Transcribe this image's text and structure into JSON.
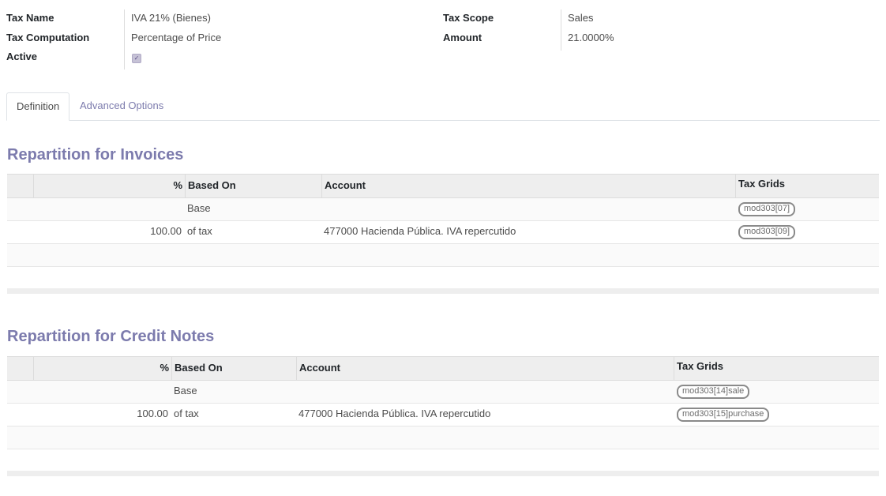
{
  "header": {
    "tax_name_label": "Tax Name",
    "tax_name_value": "IVA 21% (Bienes)",
    "tax_computation_label": "Tax Computation",
    "tax_computation_value": "Percentage of Price",
    "active_label": "Active",
    "active_checked": true,
    "tax_scope_label": "Tax Scope",
    "tax_scope_value": "Sales",
    "amount_label": "Amount",
    "amount_value": "21.0000%"
  },
  "tabs": [
    {
      "label": "Definition",
      "active": true
    },
    {
      "label": "Advanced Options",
      "active": false
    }
  ],
  "invoices": {
    "title": "Repartition for Invoices",
    "columns": {
      "percent": "%",
      "based_on": "Based On",
      "account": "Account",
      "tax_grids": "Tax Grids"
    },
    "rows": [
      {
        "percent": "",
        "based_on": "Base",
        "account": "",
        "tax_grid": "mod303[07]"
      },
      {
        "percent": "100.00",
        "based_on": "of tax",
        "account": "477000 Hacienda Pública. IVA repercutido",
        "tax_grid": "mod303[09]"
      }
    ]
  },
  "credit_notes": {
    "title": "Repartition for Credit Notes",
    "columns": {
      "percent": "%",
      "based_on": "Based On",
      "account": "Account",
      "tax_grids": "Tax Grids"
    },
    "rows": [
      {
        "percent": "",
        "based_on": "Base",
        "account": "",
        "tax_grid": "mod303[14]sale"
      },
      {
        "percent": "100.00",
        "based_on": "of tax",
        "account": "477000 Hacienda Pública. IVA repercutido",
        "tax_grid": "mod303[15]purchase"
      }
    ]
  },
  "colors": {
    "accent": "#7c7bad",
    "text": "#4c4c4c",
    "header_bg": "#eeeeee"
  }
}
